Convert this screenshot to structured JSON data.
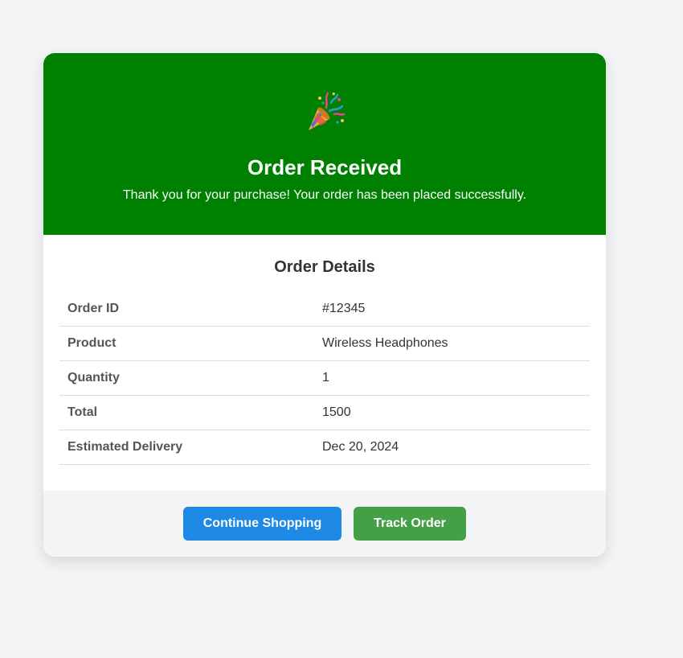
{
  "hero": {
    "icon": "party-popper-icon",
    "title": "Order Received",
    "subtitle": "Thank you for your purchase! Your order has been placed successfully."
  },
  "details": {
    "title": "Order Details",
    "rows": [
      {
        "label": "Order ID",
        "value": "#12345"
      },
      {
        "label": "Product",
        "value": "Wireless Headphones"
      },
      {
        "label": "Quantity",
        "value": "1"
      },
      {
        "label": "Total",
        "value": "1500"
      },
      {
        "label": "Estimated Delivery",
        "value": "Dec 20, 2024"
      }
    ]
  },
  "actions": {
    "continue_label": "Continue Shopping",
    "track_label": "Track Order"
  },
  "colors": {
    "hero_bg": "#008000",
    "primary": "#1e88e5",
    "success": "#43a047"
  }
}
